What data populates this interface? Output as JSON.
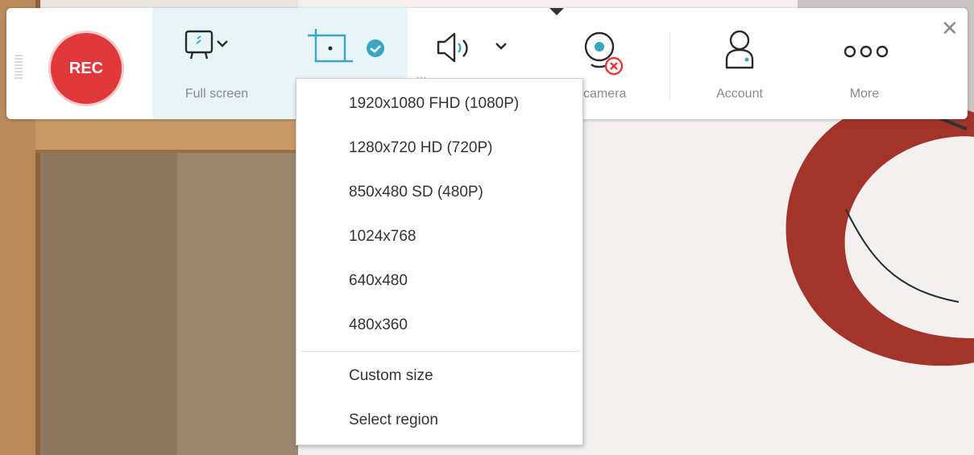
{
  "recorder": {
    "rec_label": "REC",
    "tools": {
      "full_screen": "Full screen",
      "web_camera": "b camera",
      "account": "Account",
      "more": "More"
    },
    "close_symbol": "✕",
    "more_symbol": "ooo",
    "dots": "..."
  },
  "resolution_menu": {
    "items": [
      "1920x1080 FHD (1080P)",
      "1280x720 HD (720P)",
      "850x480 SD (480P)",
      "1024x768",
      "640x480",
      "480x360"
    ],
    "extra_items": [
      "Custom size",
      "Select region"
    ]
  },
  "colors": {
    "rec": "#e0383b",
    "accent": "#3aa6c2",
    "active_tool_bg": "#e7f4f8"
  },
  "icons": [
    "monitor-icon",
    "chevron-down-icon",
    "region-crop-icon",
    "check-badge-icon",
    "speaker-icon",
    "webcam-icon",
    "webcam-off-badge-icon",
    "account-icon",
    "more-icon",
    "close-icon"
  ]
}
